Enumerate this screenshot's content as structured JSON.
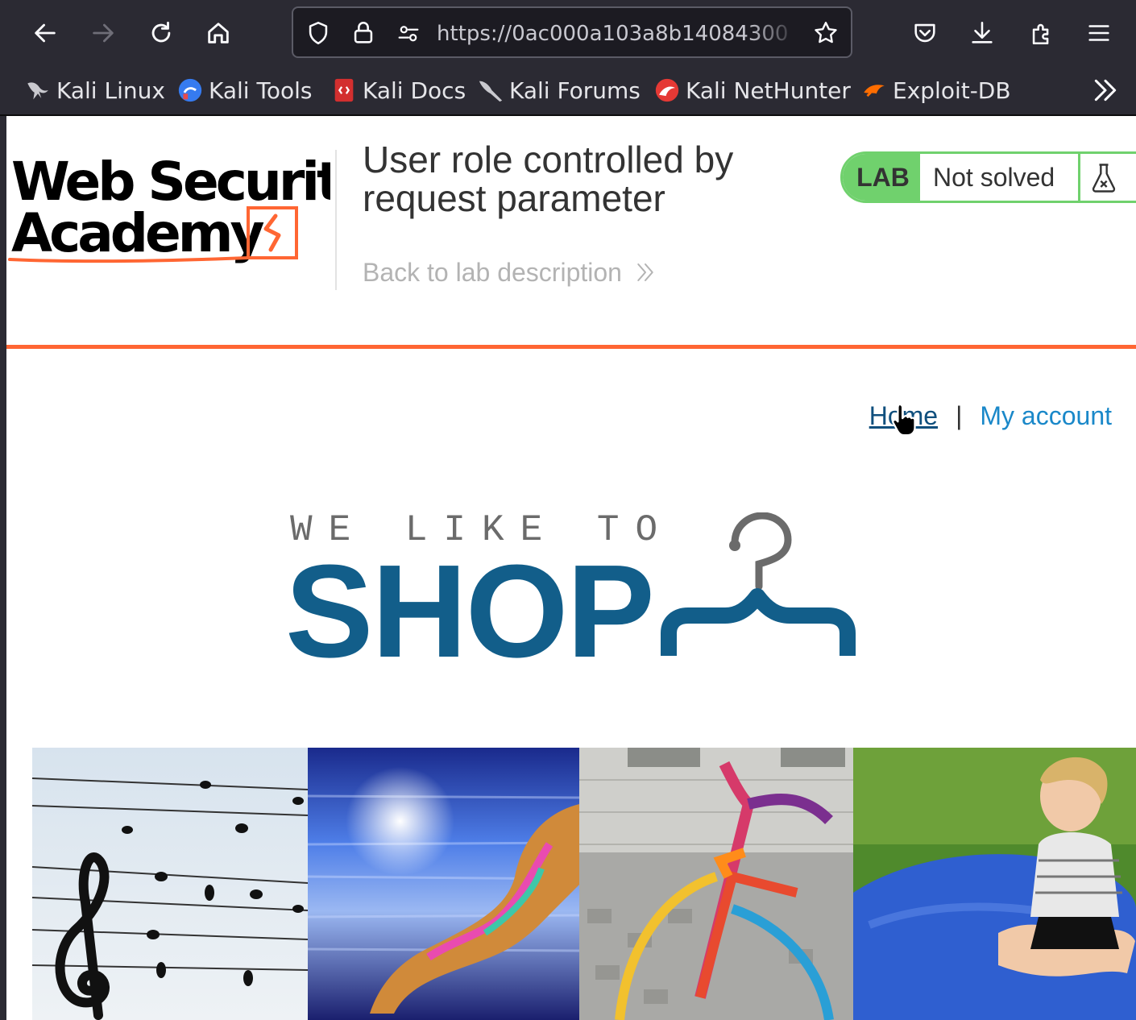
{
  "browser": {
    "url": "https://0ac000a103a8b14084300",
    "bookmarks": [
      {
        "label": "Kali Linux",
        "icon": "kali-dragon-icon"
      },
      {
        "label": "Kali Tools",
        "icon": "kali-tools-icon"
      },
      {
        "label": "Kali Docs",
        "icon": "kali-docs-icon"
      },
      {
        "label": "Kali Forums",
        "icon": "kali-forums-icon"
      },
      {
        "label": "Kali NetHunter",
        "icon": "kali-nethunter-icon"
      },
      {
        "label": "Exploit-DB",
        "icon": "exploit-db-icon"
      }
    ]
  },
  "lab": {
    "logo_line1": "Web Security",
    "logo_line2": "Academy",
    "title": "User role controlled by request parameter",
    "back_link": "Back to lab description",
    "badge": "LAB",
    "status": "Not solved"
  },
  "nav": {
    "home": "Home",
    "separator": "|",
    "account": "My account"
  },
  "shop": {
    "tagline": "WE LIKE TO",
    "word": "SHOP"
  },
  "products": [
    {
      "image": "music-notes-on-wires"
    },
    {
      "image": "speed-blur-runner"
    },
    {
      "image": "yarn-bombed-bicycle"
    },
    {
      "image": "girl-on-blue-beanbag"
    }
  ],
  "colors": {
    "chrome": "#2b2a33",
    "lab_green": "#70d16d",
    "accent_orange": "#ff6633",
    "shop_blue": "#125e8a",
    "link_blue": "#1a88c9"
  }
}
